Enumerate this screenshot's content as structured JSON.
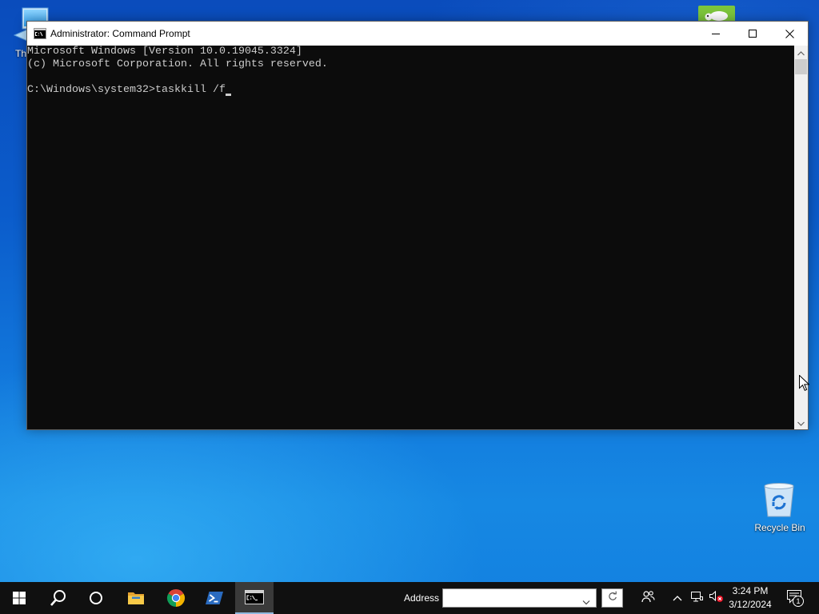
{
  "desktop": {
    "background_colors": [
      "#0a4cbc",
      "#1278dc",
      "#1688e3"
    ],
    "this_pc": {
      "icon": "this-pc-icon",
      "label": "Th"
    },
    "app_shortcut": {
      "icon": "app-shortcut-icon"
    },
    "recycle_bin": {
      "icon": "recycle-bin-icon",
      "label": "Recycle Bin"
    }
  },
  "window": {
    "title": "Administrator: Command Prompt",
    "icon": "command-prompt-icon",
    "controls": [
      "minimize-icon",
      "maximize-icon",
      "close-icon"
    ]
  },
  "terminal": {
    "lines": [
      "Microsoft Windows [Version 10.0.19045.3324]",
      "(c) Microsoft Corporation. All rights reserved."
    ],
    "prompt": "C:\\Windows\\system32>",
    "input": "taskkill /f",
    "background": "#0c0c0c",
    "foreground": "#cccccc",
    "scrollbar_icons": [
      "chevron-up-icon",
      "chevron-down-icon"
    ]
  },
  "taskbar": {
    "background": "#101010",
    "apps": [
      {
        "icon": "windows-start-icon"
      },
      {
        "icon": "search-icon"
      },
      {
        "icon": "cortana-icon"
      },
      {
        "icon": "file-explorer-icon"
      },
      {
        "icon": "chrome-icon"
      },
      {
        "icon": "powershell-icon"
      },
      {
        "icon": "command-prompt-icon",
        "active": true
      }
    ],
    "address_toolbar": {
      "label": "Address",
      "value": "",
      "icons": [
        "chevron-down-icon",
        "refresh-icon"
      ]
    },
    "tray": {
      "icons": [
        "people-icon",
        "chevron-up-icon",
        "network-icon",
        "volume-muted-icon",
        "notification-icon"
      ],
      "time": "3:24 PM",
      "date": "3/12/2024",
      "notification_count": "1"
    }
  }
}
